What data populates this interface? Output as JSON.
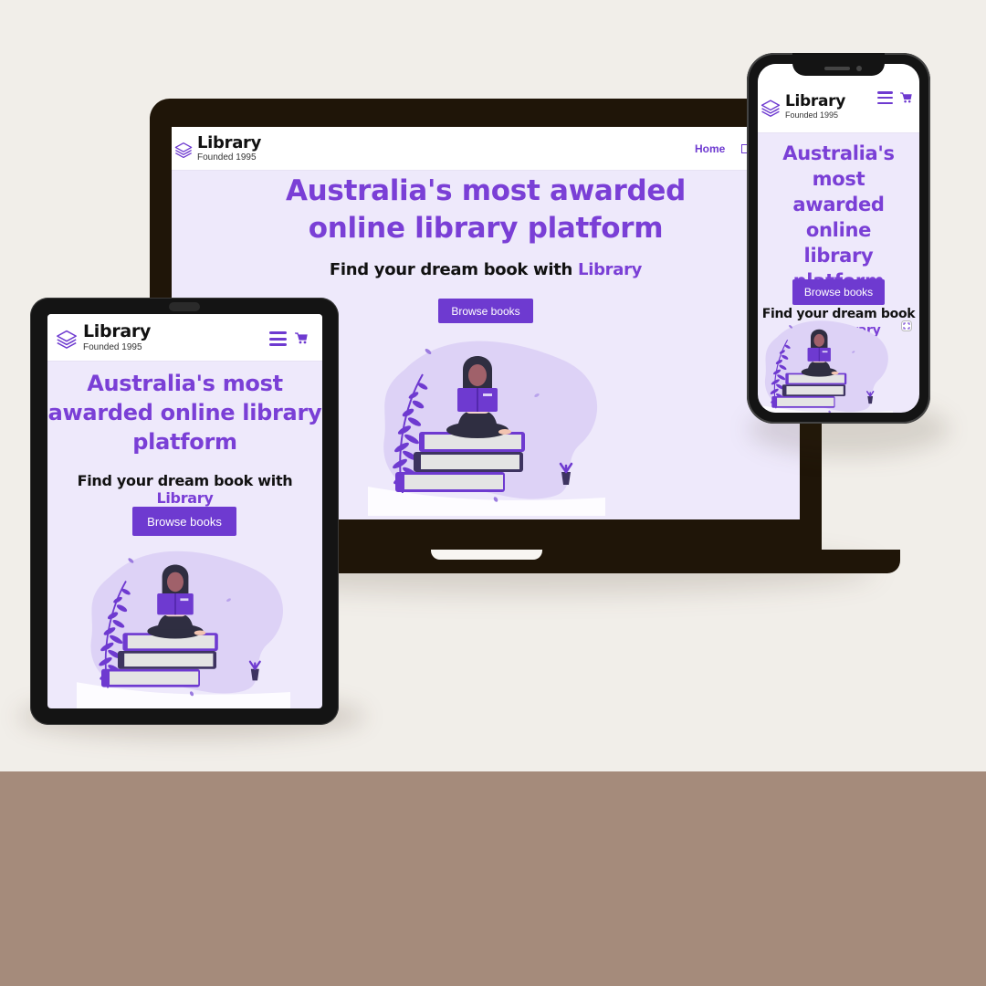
{
  "site": {
    "brand_name": "Library",
    "brand_tagline": "Founded 1995",
    "nav_home": "Home",
    "headline": "Australia's most awarded online library platform",
    "headline_desktop_line1": "Australia's most awarded",
    "headline_desktop_line2": "online library platform",
    "headline_tablet_line1": "Australia's most",
    "headline_tablet_line2": "awarded online library",
    "headline_tablet_line3": "platform",
    "headline_phone_line1": "Australia's most",
    "headline_phone_line2": "awarded online",
    "headline_phone_line3": "library platform",
    "sub_prefix": "Find your dream book with",
    "sub_phone_line1": "Find your dream book",
    "sub_phone_line2_prefix": "with",
    "sub_accent": "Library",
    "cta_label": "Browse books"
  },
  "icons": {
    "logo": "stacked-books-icon",
    "menu": "hamburger-menu-icon",
    "cart": "shopping-cart-icon",
    "extra": "screenshot-icon"
  },
  "colors": {
    "accent": "#7a3fd6",
    "button": "#6e3ad0",
    "hero_background": "#eee9fb",
    "page_background": "#f1eee9",
    "floor": "#a58b7b",
    "device_frame": "#1f1508"
  }
}
